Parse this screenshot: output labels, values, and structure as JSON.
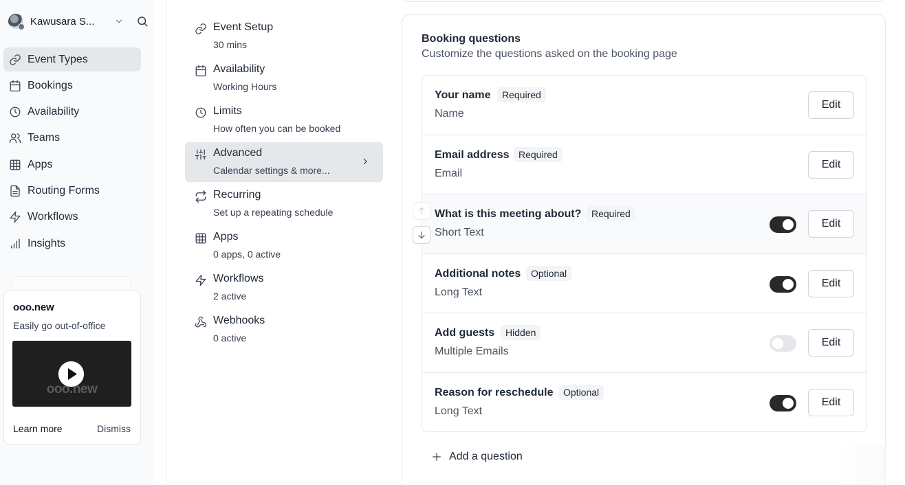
{
  "user": {
    "name": "Kawusara S..."
  },
  "nav": {
    "items": [
      {
        "label": "Event Types",
        "icon": "link-icon",
        "active": true
      },
      {
        "label": "Bookings",
        "icon": "calendar-icon"
      },
      {
        "label": "Availability",
        "icon": "clock-icon"
      },
      {
        "label": "Teams",
        "icon": "users-icon"
      },
      {
        "label": "Apps",
        "icon": "grid-icon"
      },
      {
        "label": "Routing Forms",
        "icon": "file-text-icon"
      },
      {
        "label": "Workflows",
        "icon": "zap-icon"
      },
      {
        "label": "Insights",
        "icon": "bar-chart-icon"
      }
    ]
  },
  "promo": {
    "title": "ooo.new",
    "text": "Easily go out-of-office",
    "video_watermark": "ooo.new",
    "learn_more": "Learn more",
    "dismiss": "Dismiss"
  },
  "menu": {
    "items": [
      {
        "title": "Event Setup",
        "sub": "30 mins",
        "icon": "link-icon"
      },
      {
        "title": "Availability",
        "sub": "Working Hours",
        "icon": "calendar-icon"
      },
      {
        "title": "Limits",
        "sub": "How often you can be booked",
        "icon": "clock-icon"
      },
      {
        "title": "Advanced",
        "sub": "Calendar settings & more...",
        "icon": "sliders-icon",
        "active": true
      },
      {
        "title": "Recurring",
        "sub": "Set up a repeating schedule",
        "icon": "repeat-icon"
      },
      {
        "title": "Apps",
        "sub": "0 apps, 0 active",
        "icon": "grid-icon"
      },
      {
        "title": "Workflows",
        "sub": "2 active",
        "icon": "zap-icon"
      },
      {
        "title": "Webhooks",
        "sub": "0 active",
        "icon": "webhook-icon"
      }
    ]
  },
  "booking": {
    "title": "Booking questions",
    "subtitle": "Customize the questions asked on the booking page",
    "edit_label": "Edit",
    "add_label": "Add a question",
    "questions": [
      {
        "title": "Your name",
        "badge": "Required",
        "type": "Name",
        "toggle": "none"
      },
      {
        "title": "Email address",
        "badge": "Required",
        "type": "Email",
        "toggle": "none"
      },
      {
        "title": "What is this meeting about?",
        "badge": "Required",
        "type": "Short Text",
        "toggle": "on"
      },
      {
        "title": "Additional notes",
        "badge": "Optional",
        "type": "Long Text",
        "toggle": "on"
      },
      {
        "title": "Add guests",
        "badge": "Hidden",
        "type": "Multiple Emails",
        "toggle": "off"
      },
      {
        "title": "Reason for reschedule",
        "badge": "Optional",
        "type": "Long Text",
        "toggle": "on"
      }
    ]
  },
  "colors": {
    "toggle_on": "#292929",
    "active_bg": "#e5e7eb",
    "sidebar_bg": "#f9fafb"
  }
}
